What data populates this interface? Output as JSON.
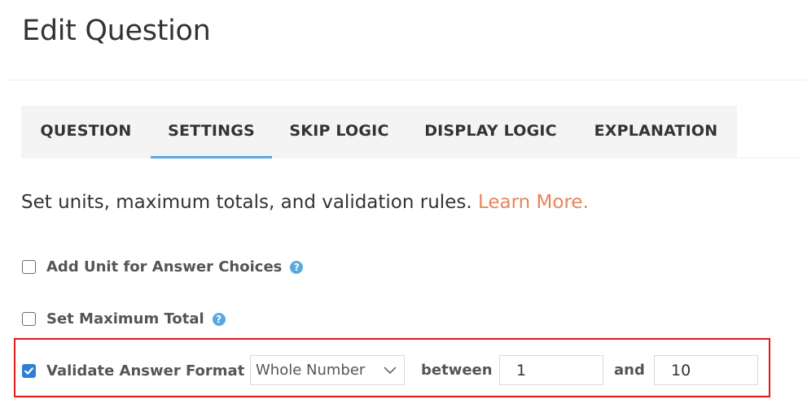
{
  "page": {
    "title": "Edit Question"
  },
  "tabs": [
    {
      "label": "QUESTION",
      "active": false
    },
    {
      "label": "SETTINGS",
      "active": true
    },
    {
      "label": "SKIP LOGIC",
      "active": false
    },
    {
      "label": "DISPLAY LOGIC",
      "active": false
    },
    {
      "label": "EXPLANATION",
      "active": false
    }
  ],
  "description": {
    "text": "Set units, maximum totals, and validation rules.",
    "link": "Learn More."
  },
  "options": {
    "add_unit": {
      "label": "Add Unit for Answer Choices",
      "checked": false,
      "help": "?"
    },
    "max_total": {
      "label": "Set Maximum Total",
      "checked": false,
      "help": "?"
    },
    "validate": {
      "label": "Validate Answer Format",
      "checked": true,
      "format_selected": "Whole Number",
      "between_label": "between",
      "and_label": "and",
      "min_value": "1",
      "max_value": "10"
    }
  },
  "colors": {
    "accent_blue": "#5aa8e0",
    "link_orange": "#e8845a",
    "highlight_red": "#e11a1a",
    "checkbox_blue": "#2f7fd6"
  }
}
